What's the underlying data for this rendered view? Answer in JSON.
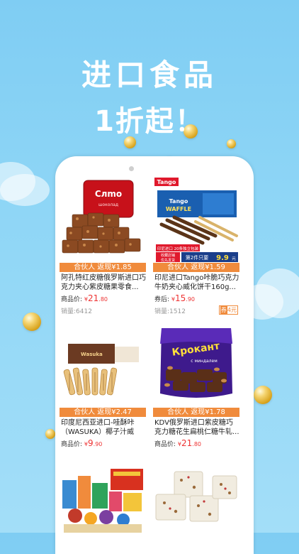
{
  "banner": {
    "title": "进口食品",
    "subtitle": "1折起！"
  },
  "products": [
    {
      "image_text": [
        "Слmo",
        "шоколад"
      ],
      "rebate": "合伙人 返现¥1.85",
      "title": "阿孔特红皮糖俄罗斯进口巧克力夹心紫皮糖果零食...",
      "price_label": "商品价:",
      "price_symbol": "¥",
      "price_int": "21",
      "price_dec": ".80",
      "sales": "销量:6412"
    },
    {
      "image_text": [
        "Tango",
        "WAFFLE",
        "印尼进口 20条独立包装",
        "第2件只要",
        "9.9",
        "元",
        "收藏店铺",
        "优先发货"
      ],
      "rebate": "合伙人 返现¥1.59",
      "title": "印尼进口Tango咔脆巧克力牛奶夹心威化饼干160g...",
      "price_label": "券后:",
      "price_symbol": "¥",
      "price_int": "15",
      "price_dec": ".90",
      "sales": "销量:1512",
      "coupon_tag": "券",
      "coupon_value": "4元"
    },
    {
      "image_text": [
        "Wasuka"
      ],
      "rebate": "合伙人 返现¥2.47",
      "title": "印度尼西亚进口-哇酥咔（WASUKA）椰子汁威化...",
      "price_label": "商品价:",
      "price_symbol": "¥",
      "price_int": "9",
      "price_dec": ".90"
    },
    {
      "image_text": [
        "Кpoкaнт",
        "с миндалем"
      ],
      "rebate": "合伙人 返现¥1.78",
      "title": "KDV俄罗斯进口紫皮糖巧克力糖花生扁桃仁糖牛轧...",
      "price_label": "商品价:",
      "price_symbol": "¥",
      "price_int": "21",
      "price_dec": ".80"
    },
    {},
    {}
  ],
  "colors": {
    "accent": "#f08b3c",
    "price": "#e33333",
    "background": "#8fd6f6"
  },
  "icons": [
    "pearl-decoration",
    "cloud-heart-decoration"
  ]
}
